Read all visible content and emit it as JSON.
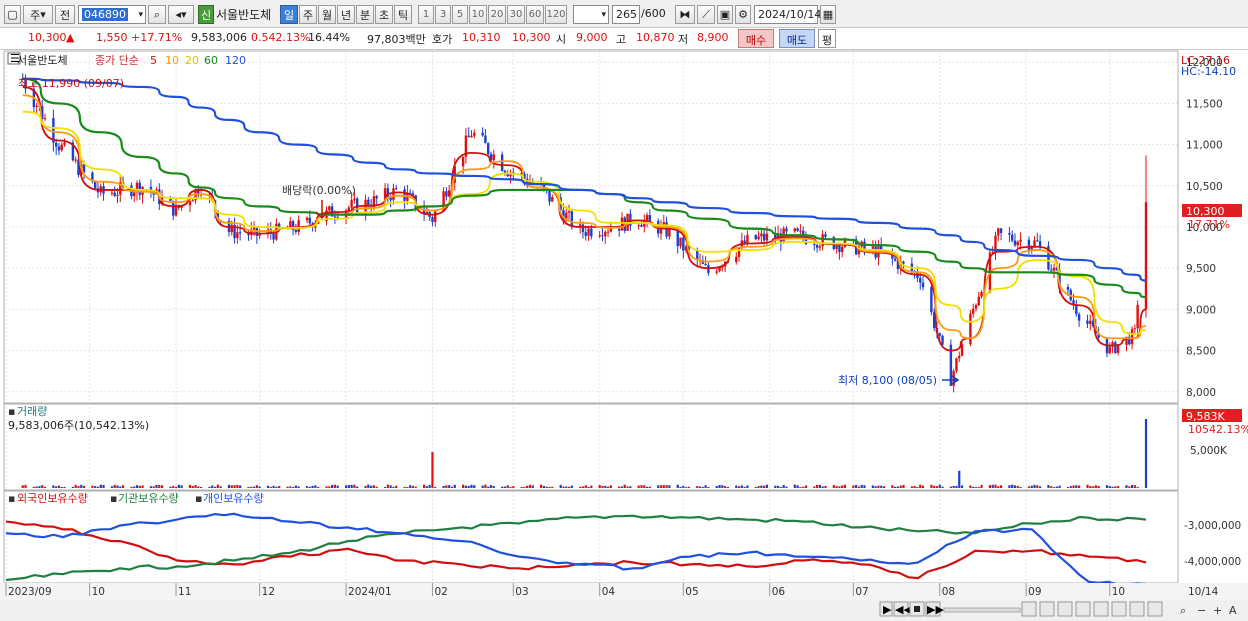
{
  "toolbar": {
    "chart_type_label": "주",
    "code_label": "전",
    "stock_code": "046890",
    "new_label": "신",
    "stock_name": "서울반도체",
    "periods": [
      "일",
      "주",
      "월",
      "년",
      "분",
      "초",
      "틱"
    ],
    "active_period": "일",
    "intervals": [
      "1",
      "3",
      "5",
      "10",
      "20",
      "30",
      "60",
      "120"
    ],
    "count_value": "265",
    "count_max": "/600",
    "date": "2024/10/14"
  },
  "quote": {
    "price": "10,300",
    "arrow": "▲",
    "change": "1,550",
    "change_pct": "+17.71%",
    "volume": "9,583,006",
    "turnover_pct": "0.542.13%",
    "ratio_pct": "16.44%",
    "amount": "97,803백만",
    "bid_label": "호가",
    "bid1": "10,310",
    "bid2": "10,300",
    "open_label": "시",
    "open": "9,000",
    "high_label": "고",
    "high": "10,870",
    "low_label": "저",
    "low": "8,900",
    "buy_label": "매수",
    "sell_label": "매도",
    "eval_label": "평"
  },
  "price_panel": {
    "title": "서울반도체",
    "ma_label": "종가 단순",
    "ma_periods": [
      "5",
      "10",
      "20",
      "60",
      "120"
    ],
    "high_note": "최고 11,990 (09/07)",
    "low_note": "최저 8,100 (08/05)",
    "dividend_note": "배당락(0.00%)",
    "lc": "LC:27.16",
    "hc": "HC:-14.10",
    "last_price_tag": "10,300",
    "last_pct_tag": "17.71%"
  },
  "volume_panel": {
    "title": "거래량",
    "value_line": "9,583,006주(10,542.13%)",
    "tag_value": "9,583K",
    "tag_pct": "10542.13%",
    "axis_label": "5,000K"
  },
  "holding_panel": {
    "legend": [
      "외국인보유수량",
      "기관보유수량",
      "개인보유수량"
    ],
    "axis_labels": [
      "-3,000,000",
      "-4,000,000"
    ]
  },
  "x_labels": [
    "2023/09",
    "10",
    "11",
    "12",
    "2024/01",
    "02",
    "03",
    "04",
    "05",
    "06",
    "07",
    "08",
    "09",
    "10",
    "10/14"
  ],
  "colors": {
    "up": "#e01010",
    "down": "#1c3fd0",
    "ma5": "#d01010",
    "ma10": "#ff9a10",
    "ma20": "#f0e000",
    "ma60": "#1a8a1a",
    "ma120": "#2050e0",
    "foreign": "#d01010",
    "institution": "#1f8040",
    "individual": "#2050e0"
  },
  "chart_data": [
    {
      "type": "line",
      "title": "서울반도체",
      "x_range": [
        "2023/09",
        "2024/10/14"
      ],
      "ylim": [
        7900,
        12100
      ],
      "y_ticks": [
        8000,
        8500,
        9000,
        9500,
        10000,
        10500,
        11000,
        11500,
        12000
      ],
      "grid": true,
      "series": [
        {
          "name": "종가",
          "x": [
            "2023/09/07",
            "2023/09/20",
            "2023/10/05",
            "2023/10/20",
            "2023/11/01",
            "2023/11/10",
            "2023/11/20",
            "2023/12/01",
            "2023/12/15",
            "2023/12/28",
            "2024/01/10",
            "2024/01/20",
            "2024/02/01",
            "2024/02/15",
            "2024/02/28",
            "2024/03/10",
            "2024/03/25",
            "2024/04/05",
            "2024/04/15",
            "2024/04/25",
            "2024/05/10",
            "2024/05/25",
            "2024/06/10",
            "2024/06/25",
            "2024/07/10",
            "2024/07/25",
            "2024/08/05",
            "2024/08/12",
            "2024/08/22",
            "2024/09/05",
            "2024/09/20",
            "2024/10/01",
            "2024/10/10",
            "2024/10/14"
          ],
          "values": [
            11800,
            11000,
            10400,
            10500,
            10200,
            10500,
            9950,
            9900,
            10000,
            10200,
            10300,
            10450,
            10100,
            11150,
            10700,
            10500,
            9950,
            10000,
            10100,
            9950,
            9450,
            9850,
            9900,
            9800,
            9700,
            9400,
            8150,
            8900,
            9900,
            9800,
            8950,
            8500,
            8700,
            10300
          ]
        },
        {
          "name": "5",
          "values": [
            11700,
            11050,
            10450,
            10450,
            10250,
            10450,
            10000,
            9920,
            10000,
            10180,
            10260,
            10420,
            10150,
            10900,
            10750,
            10480,
            10000,
            10000,
            10080,
            9980,
            9500,
            9800,
            9880,
            9790,
            9690,
            9420,
            8500,
            8650,
            9700,
            9760,
            9050,
            8560,
            8650,
            9000
          ]
        },
        {
          "name": "10",
          "values": [
            11600,
            11150,
            10550,
            10430,
            10300,
            10400,
            10050,
            9950,
            9990,
            10150,
            10230,
            10380,
            10200,
            10700,
            10800,
            10480,
            10050,
            9990,
            10050,
            10000,
            9580,
            9760,
            9860,
            9800,
            9700,
            9450,
            8750,
            8650,
            9500,
            9720,
            9150,
            8650,
            8650,
            8800
          ]
        },
        {
          "name": "20",
          "values": [
            11400,
            11200,
            10700,
            10450,
            10350,
            10350,
            10150,
            10000,
            9990,
            10100,
            10180,
            10300,
            10250,
            10400,
            10650,
            10550,
            10200,
            10050,
            10050,
            10020,
            9700,
            9720,
            9820,
            9800,
            9720,
            9500,
            9050,
            8850,
            9250,
            9600,
            9400,
            8850,
            8700,
            8750
          ]
        },
        {
          "name": "60",
          "values": [
            11800,
            11500,
            11150,
            10850,
            10650,
            10480,
            10350,
            10250,
            10180,
            10150,
            10150,
            10200,
            10250,
            10380,
            10450,
            10450,
            10450,
            10400,
            10300,
            10200,
            10100,
            9980,
            9900,
            9850,
            9780,
            9700,
            9580,
            9500,
            9450,
            9450,
            9420,
            9300,
            9200,
            9150
          ]
        },
        {
          "name": "120",
          "values": [
            11800,
            11780,
            11750,
            11700,
            11580,
            11450,
            11300,
            11150,
            11000,
            10880,
            10780,
            10700,
            10650,
            10620,
            10580,
            10520,
            10450,
            10400,
            10350,
            10300,
            10230,
            10170,
            10130,
            10100,
            10050,
            9980,
            9900,
            9820,
            9720,
            9650,
            9600,
            9500,
            9420,
            9350
          ]
        }
      ]
    },
    {
      "type": "bar",
      "title": "거래량",
      "unit": "K",
      "ylim": [
        0,
        10000
      ],
      "x": [
        "2023/09",
        "2024/02/01",
        "2024/08/08",
        "2024/10/14"
      ],
      "values": [
        300,
        5000,
        2400,
        9583
      ]
    },
    {
      "type": "line",
      "ylim": [
        -4300000,
        -2400000
      ],
      "y_ticks": [
        -3000000,
        -4000000
      ],
      "series": [
        {
          "name": "외국인보유수량",
          "values": [
            -2800000,
            -3000000,
            -3300000,
            -3800000,
            -3900000,
            -3700000,
            -3500000,
            -3800000,
            -3900000,
            -4000000,
            -3900000,
            -3850000,
            -3900000,
            -3950000,
            -3800000,
            -3900000,
            -4250000,
            -3550000,
            -3550000,
            -3700000,
            -3850000
          ]
        },
        {
          "name": "기관보유수량",
          "values": [
            -4300000,
            -4150000,
            -4000000,
            -3950000,
            -3800000,
            -3600000,
            -3300000,
            -3100000,
            -2950000,
            -2850000,
            -2700000,
            -2650000,
            -2700000,
            -2750000,
            -2800000,
            -2950000,
            -3050000,
            -3100000,
            -2850000,
            -2700000,
            -2750000
          ]
        },
        {
          "name": "개인보유수량",
          "values": [
            -3100000,
            -3200000,
            -2900000,
            -2750000,
            -2600000,
            -2800000,
            -2950000,
            -3100000,
            -3300000,
            -3700000,
            -3900000,
            -4000000,
            -3700000,
            -3600000,
            -3700000,
            -3800000,
            -3850000,
            -3050000,
            -3000000,
            -4350000,
            -4400000
          ]
        }
      ]
    }
  ]
}
